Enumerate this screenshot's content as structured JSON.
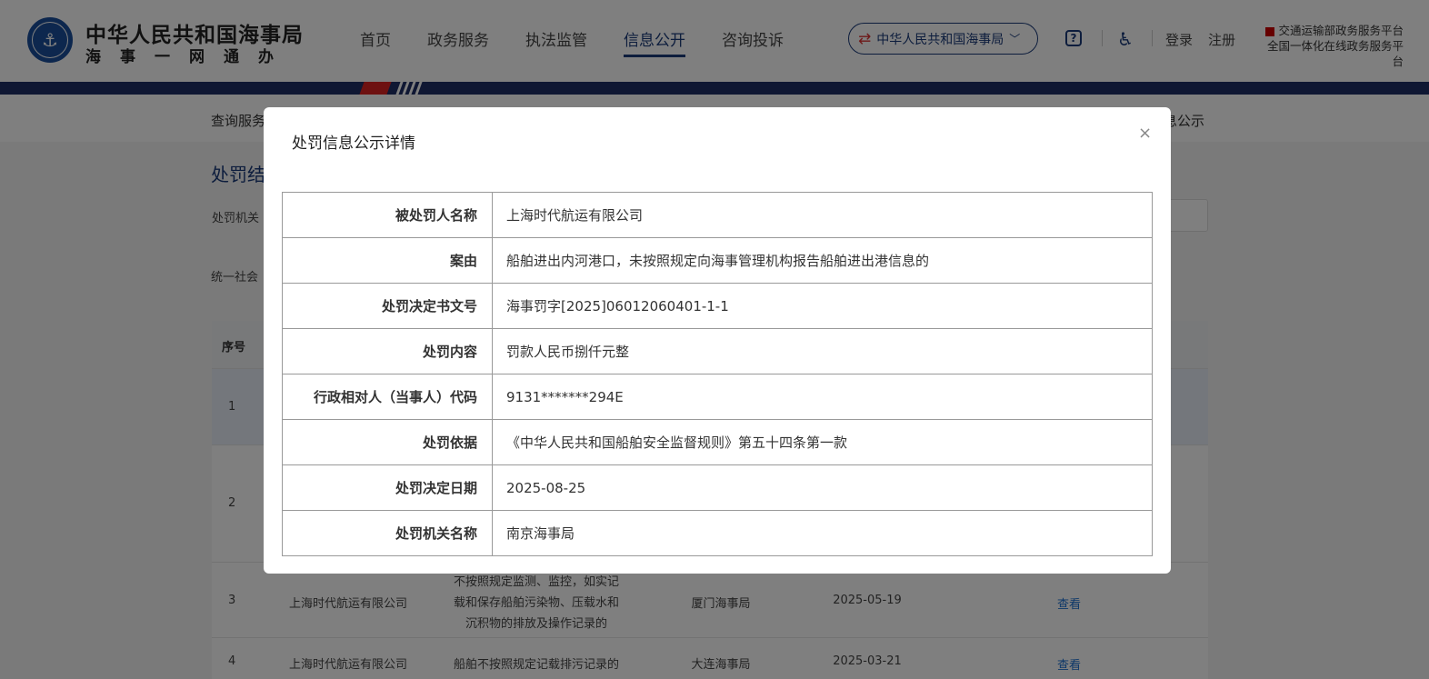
{
  "header": {
    "logo_glyph": "⚓",
    "title": "中华人民共和国海事局",
    "subtitle": "海事一网通办",
    "nav": [
      "首页",
      "政务服务",
      "执法监管",
      "信息公开",
      "咨询投诉"
    ],
    "active_nav_index": 3,
    "org_select": "中华人民共和国海事局",
    "login": "登录",
    "register": "注册",
    "platform_line1": "交通运输部政务服务平台",
    "platform_line2": "全国一体化在线政务服务平台"
  },
  "subnav": {
    "left": "查询服务",
    "right": "息公示"
  },
  "page": {
    "title": "处罚结",
    "filter_label": "处罚机关",
    "filter_label2": "统一社会"
  },
  "table": {
    "header_index": "序号",
    "rows": [
      {
        "index": "1"
      },
      {
        "index": "2"
      },
      {
        "index": "3",
        "party": "上海时代航运有限公司",
        "reason_lines": [
          "不按照规定监测、监控，如实记",
          "载和保存船舶污染物、压载水和",
          "沉积物的排放及操作记录的"
        ],
        "org": "厦门海事局",
        "date": "2025-05-19",
        "action": "查看"
      },
      {
        "index": "4",
        "party": "上海时代航运有限公司",
        "reason": "船舶不按照规定记载排污记录的",
        "org": "大连海事局",
        "date": "2025-03-21",
        "action": "查看"
      }
    ]
  },
  "modal": {
    "title": "处罚信息公示详情",
    "close": "×",
    "rows": [
      {
        "label": "被处罚人名称",
        "value": "上海时代航运有限公司"
      },
      {
        "label": "案由",
        "value": "船舶进出内河港口，未按照规定向海事管理机构报告船舶进出港信息的"
      },
      {
        "label": "处罚决定书文号",
        "value": "海事罚字[2025]06012060401-1-1"
      },
      {
        "label": "处罚内容",
        "value": "罚款人民币捌仟元整"
      },
      {
        "label": "行政相对人（当事人）代码",
        "value": "9131*******294E"
      },
      {
        "label": "处罚依据",
        "value": "《中华人民共和国船舶安全监督规则》第五十四条第一款"
      },
      {
        "label": "处罚决定日期",
        "value": "2025-08-25"
      },
      {
        "label": "处罚机关名称",
        "value": "南京海事局"
      }
    ]
  },
  "colors": {
    "brand_blue": "#1a3a7a",
    "band_blue": "#1f2e66",
    "accent_red": "#d22",
    "link": "#1a6fd1"
  }
}
